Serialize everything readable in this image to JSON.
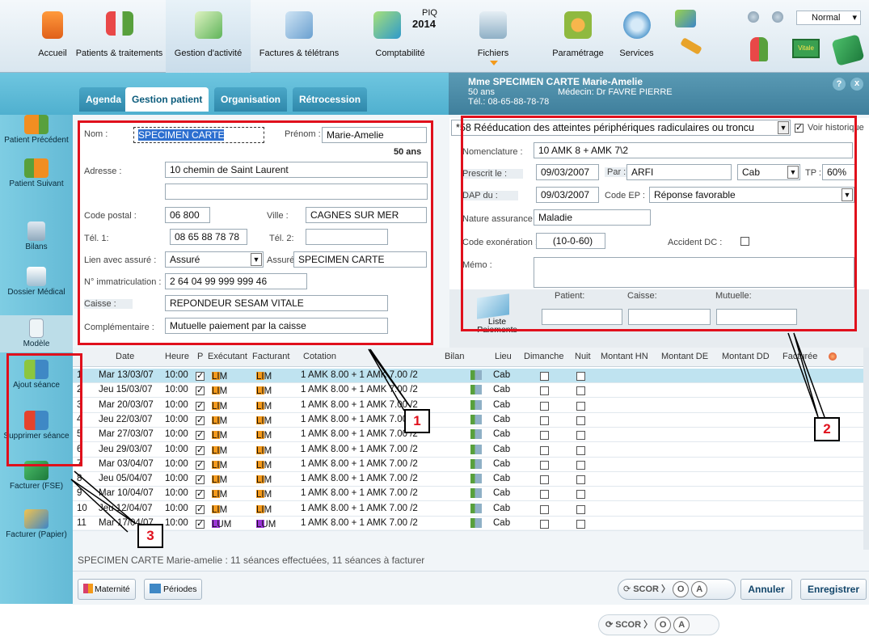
{
  "toolbar": {
    "items": [
      {
        "label": "Accueil",
        "icon": "home-icon"
      },
      {
        "label": "Patients & traitements",
        "icon": "patients-icon"
      },
      {
        "label": "Gestion d'activité",
        "icon": "activity-icon"
      },
      {
        "label": "Factures & télétrans",
        "icon": "invoice-icon"
      },
      {
        "label": "Comptabilité",
        "icon": "accounting-icon"
      },
      {
        "label": "Fichiers",
        "icon": "files-icon"
      },
      {
        "label": "Paramétrage",
        "icon": "settings-icon"
      },
      {
        "label": "Services",
        "icon": "services-icon"
      }
    ],
    "piq_label": "PIQ",
    "piq_year": "2014",
    "mode_value": "Normal",
    "vitale_label": "Vitale"
  },
  "tabs": [
    "Agenda",
    "Gestion patient",
    "Organisation",
    "Rétrocession"
  ],
  "patient_header": {
    "name": "Mme SPECIMEN CARTE Marie-Amelie",
    "age": "50 ans",
    "tel": "Tél.: 08-65-88-78-78",
    "doctor": "Médecin: Dr FAVRE PIERRE",
    "help": "?",
    "close": "x"
  },
  "sidebar": [
    "Patient Précédent",
    "Patient Suivant",
    "Bilans",
    "Dossier Médical",
    "Modèle",
    "Ajout séance",
    "Supprimer séance",
    "Facturer (FSE)",
    "Facturer (Papier)"
  ],
  "patient_form": {
    "nom_label": "Nom :",
    "nom": "SPECIMEN CARTE",
    "prenom_label": "Prénom :",
    "prenom": "Marie-Amelie",
    "age": "50 ans",
    "adresse_label": "Adresse :",
    "adresse1": "10 chemin de Saint Laurent",
    "adresse2": "",
    "cp_label": "Code postal :",
    "cp": "06 800",
    "ville_label": "Ville :",
    "ville": "CAGNES SUR MER",
    "tel1_label": "Tél. 1:",
    "tel1": "08 65 88 78 78",
    "tel2_label": "Tél. 2:",
    "tel2": "",
    "lien_label": "Lien avec assuré :",
    "lien": "Assuré",
    "assure_label": "Assuré :",
    "assure": "SPECIMEN CARTE",
    "immat_label": "N° immatriculation :",
    "immat": "2 64 04 99 999 999 46",
    "caisse_label": "Caisse :",
    "caisse": "REPONDEUR SESAM VITALE",
    "compl_label": "Complémentaire :",
    "compl": "Mutuelle paiement par la caisse"
  },
  "presc_form": {
    "pathology": "*58 Rééducation des atteintes périphériques radiculaires ou troncu",
    "historique_label": "Voir historique",
    "nomenclature_label": "Nomenclature :",
    "nomenclature": "10 AMK 8 + AMK 7\\2",
    "prescrit_label": "Prescrit le :",
    "prescrit": "09/03/2007",
    "par_label": "Par :",
    "par": "ARFI",
    "cab": "Cab",
    "tp_label": "TP :",
    "tp": "60%",
    "dap_label": "DAP du :",
    "dap": "09/03/2007",
    "codeep_label": "Code EP :",
    "codeep": "Réponse favorable",
    "nature_label": "Nature assurance :",
    "nature": "Maladie",
    "exo_label": "Code exonération :",
    "exo": "(10-0-60)",
    "accident_label": "Accident DC :",
    "memo_label": "Mémo :",
    "patient_label": "Patient:",
    "caisse_label": "Caisse:",
    "mutuelle_label": "Mutuelle:",
    "liste_label": "Liste Paiements"
  },
  "grid": {
    "headers": [
      "Date",
      "Heure",
      "P",
      "Exécutant",
      "Facturant",
      "Cotation",
      "Bilan",
      "Lieu",
      "Dimanche",
      "Nuit",
      "Montant HN",
      "Montant DE",
      "Montant DD",
      "Facturée"
    ],
    "rows": [
      {
        "n": "1",
        "date": "Mar 13/03/07",
        "heure": "10:00",
        "exe": "LIM",
        "fac": "LIM",
        "cot": "1 AMK 8.00 + 1 AMK 7.00 /2",
        "lieu": "Cab"
      },
      {
        "n": "2",
        "date": "Jeu 15/03/07",
        "heure": "10:00",
        "exe": "LIM",
        "fac": "LIM",
        "cot": "1 AMK 8.00 + 1 AMK 7.00 /2",
        "lieu": "Cab"
      },
      {
        "n": "3",
        "date": "Mar 20/03/07",
        "heure": "10:00",
        "exe": "LIM",
        "fac": "LIM",
        "cot": "1 AMK 8.00 + 1 AMK 7.00 /2",
        "lieu": "Cab"
      },
      {
        "n": "4",
        "date": "Jeu 22/03/07",
        "heure": "10:00",
        "exe": "LIM",
        "fac": "LIM",
        "cot": "1 AMK 8.00 + 1 AMK 7.00 /2",
        "lieu": "Cab"
      },
      {
        "n": "5",
        "date": "Mar 27/03/07",
        "heure": "10:00",
        "exe": "LIM",
        "fac": "LIM",
        "cot": "1 AMK 8.00 + 1 AMK 7.00 /2",
        "lieu": "Cab"
      },
      {
        "n": "6",
        "date": "Jeu 29/03/07",
        "heure": "10:00",
        "exe": "LIM",
        "fac": "LIM",
        "cot": "1 AMK 8.00 + 1 AMK 7.00 /2",
        "lieu": "Cab"
      },
      {
        "n": "7",
        "date": "Mar 03/04/07",
        "heure": "10:00",
        "exe": "LIM",
        "fac": "LIM",
        "cot": "1 AMK 8.00 + 1 AMK 7.00 /2",
        "lieu": "Cab"
      },
      {
        "n": "8",
        "date": "Jeu 05/04/07",
        "heure": "10:00",
        "exe": "LIM",
        "fac": "LIM",
        "cot": "1 AMK 8.00 + 1 AMK 7.00 /2",
        "lieu": "Cab"
      },
      {
        "n": "9",
        "date": "Mar 10/04/07",
        "heure": "10:00",
        "exe": "LIM",
        "fac": "LIM",
        "cot": "1 AMK 8.00 + 1 AMK 7.00 /2",
        "lieu": "Cab"
      },
      {
        "n": "10",
        "date": "Jeu 12/04/07",
        "heure": "10:00",
        "exe": "LIM",
        "fac": "LIM",
        "cot": "1 AMK 8.00 + 1 AMK 7.00 /2",
        "lieu": "Cab"
      },
      {
        "n": "11",
        "date": "Mar 17/04/07",
        "heure": "10:00",
        "exe": "LUM",
        "fac": "LUM",
        "cot": "1 AMK 8.00 + 1 AMK 7.00 /2",
        "lieu": "Cab"
      }
    ]
  },
  "summary": "SPECIMEN CARTE Marie-amelie : 11 séances effectuées, 11 séances à facturer",
  "footer": {
    "maternite": "Maternité",
    "periodes": "Périodes",
    "scor": "SCOR",
    "o": "O",
    "a": "A",
    "annuler": "Annuler",
    "enregistrer": "Enregistrer"
  },
  "callouts": [
    "1",
    "2",
    "3"
  ],
  "colors": {
    "annotation": "#e0101c",
    "orange": "#f59a1b",
    "purple": "#9b35d6",
    "selected": "#bfe3f0"
  }
}
